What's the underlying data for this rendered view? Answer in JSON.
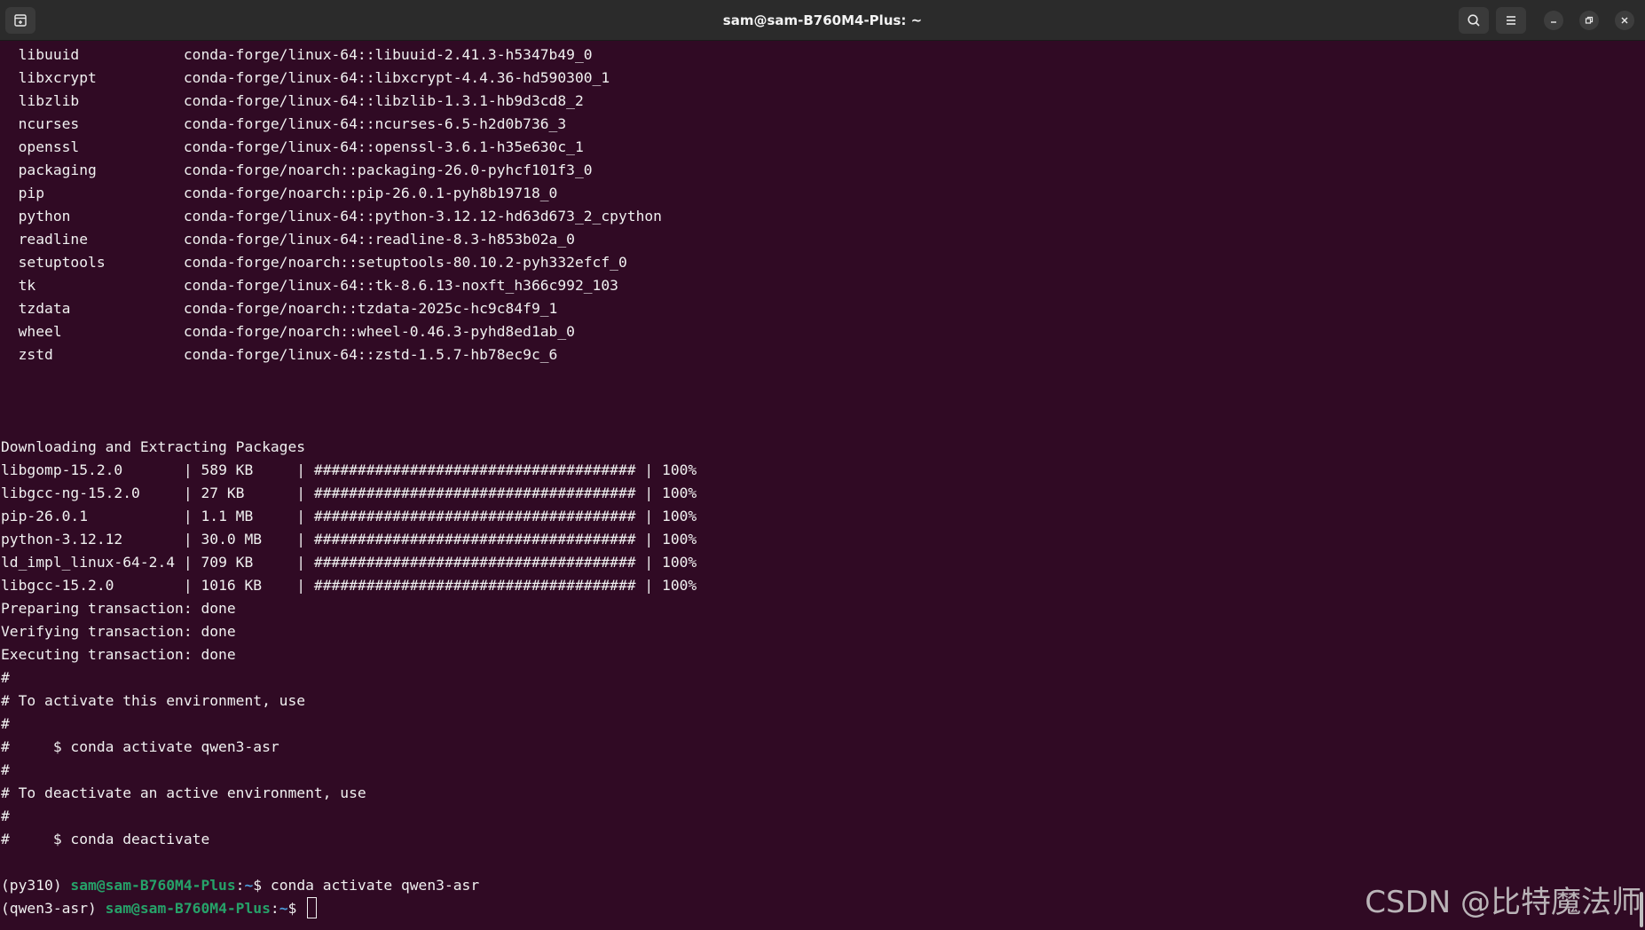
{
  "window": {
    "title": "sam@sam-B760M4-Plus: ~",
    "icons": {
      "new_tab": "new-tab-icon",
      "search": "search-icon",
      "menu": "hamburger-menu-icon",
      "minimize": "minimize-icon",
      "restore": "restore-icon",
      "close": "close-icon"
    }
  },
  "terminal": {
    "packages": [
      {
        "name": "libuuid",
        "spec": "conda-forge/linux-64::libuuid-2.41.3-h5347b49_0"
      },
      {
        "name": "libxcrypt",
        "spec": "conda-forge/linux-64::libxcrypt-4.4.36-hd590300_1"
      },
      {
        "name": "libzlib",
        "spec": "conda-forge/linux-64::libzlib-1.3.1-hb9d3cd8_2"
      },
      {
        "name": "ncurses",
        "spec": "conda-forge/linux-64::ncurses-6.5-h2d0b736_3"
      },
      {
        "name": "openssl",
        "spec": "conda-forge/linux-64::openssl-3.6.1-h35e630c_1"
      },
      {
        "name": "packaging",
        "spec": "conda-forge/noarch::packaging-26.0-pyhcf101f3_0"
      },
      {
        "name": "pip",
        "spec": "conda-forge/noarch::pip-26.0.1-pyh8b19718_0"
      },
      {
        "name": "python",
        "spec": "conda-forge/linux-64::python-3.12.12-hd63d673_2_cpython"
      },
      {
        "name": "readline",
        "spec": "conda-forge/linux-64::readline-8.3-h853b02a_0"
      },
      {
        "name": "setuptools",
        "spec": "conda-forge/noarch::setuptools-80.10.2-pyh332efcf_0"
      },
      {
        "name": "tk",
        "spec": "conda-forge/linux-64::tk-8.6.13-noxft_h366c992_103"
      },
      {
        "name": "tzdata",
        "spec": "conda-forge/noarch::tzdata-2025c-hc9c84f9_1"
      },
      {
        "name": "wheel",
        "spec": "conda-forge/noarch::wheel-0.46.3-pyhd8ed1ab_0"
      },
      {
        "name": "zstd",
        "spec": "conda-forge/linux-64::zstd-1.5.7-hb78ec9c_6"
      }
    ],
    "download_header": "Downloading and Extracting Packages",
    "downloads": [
      {
        "name": "libgomp-15.2.0",
        "size": "589 KB",
        "bar": "#####################################",
        "percent": "100%"
      },
      {
        "name": "libgcc-ng-15.2.0",
        "size": "27 KB",
        "bar": "#####################################",
        "percent": "100%"
      },
      {
        "name": "pip-26.0.1",
        "size": "1.1 MB",
        "bar": "#####################################",
        "percent": "100%"
      },
      {
        "name": "python-3.12.12",
        "size": "30.0 MB",
        "bar": "#####################################",
        "percent": "100%"
      },
      {
        "name": "ld_impl_linux-64-2.4",
        "size": "709 KB",
        "bar": "#####################################",
        "percent": "100%"
      },
      {
        "name": "libgcc-15.2.0",
        "size": "1016 KB",
        "bar": "#####################################",
        "percent": "100%"
      }
    ],
    "status_lines": [
      "Preparing transaction: done",
      "Verifying transaction: done",
      "Executing transaction: done"
    ],
    "comment_lines": [
      "#",
      "# To activate this environment, use",
      "#",
      "#     $ conda activate qwen3-asr",
      "#",
      "# To deactivate an active environment, use",
      "#",
      "#     $ conda deactivate"
    ],
    "prompt1": {
      "env": "(py310) ",
      "user_host": "sam@sam-B760M4-Plus",
      "sep": ":",
      "path": "~",
      "dollar": "$ ",
      "command": "conda activate qwen3-asr"
    },
    "prompt2": {
      "env": "(qwen3-asr) ",
      "user_host": "sam@sam-B760M4-Plus",
      "sep": ":",
      "path": "~",
      "dollar": "$ ",
      "command": ""
    }
  },
  "watermark": "CSDN @比特魔法师",
  "colors": {
    "background": "#300a24",
    "prompt_user": "#26a269",
    "prompt_path": "#4b9bd8",
    "text": "#f0f0f0"
  }
}
